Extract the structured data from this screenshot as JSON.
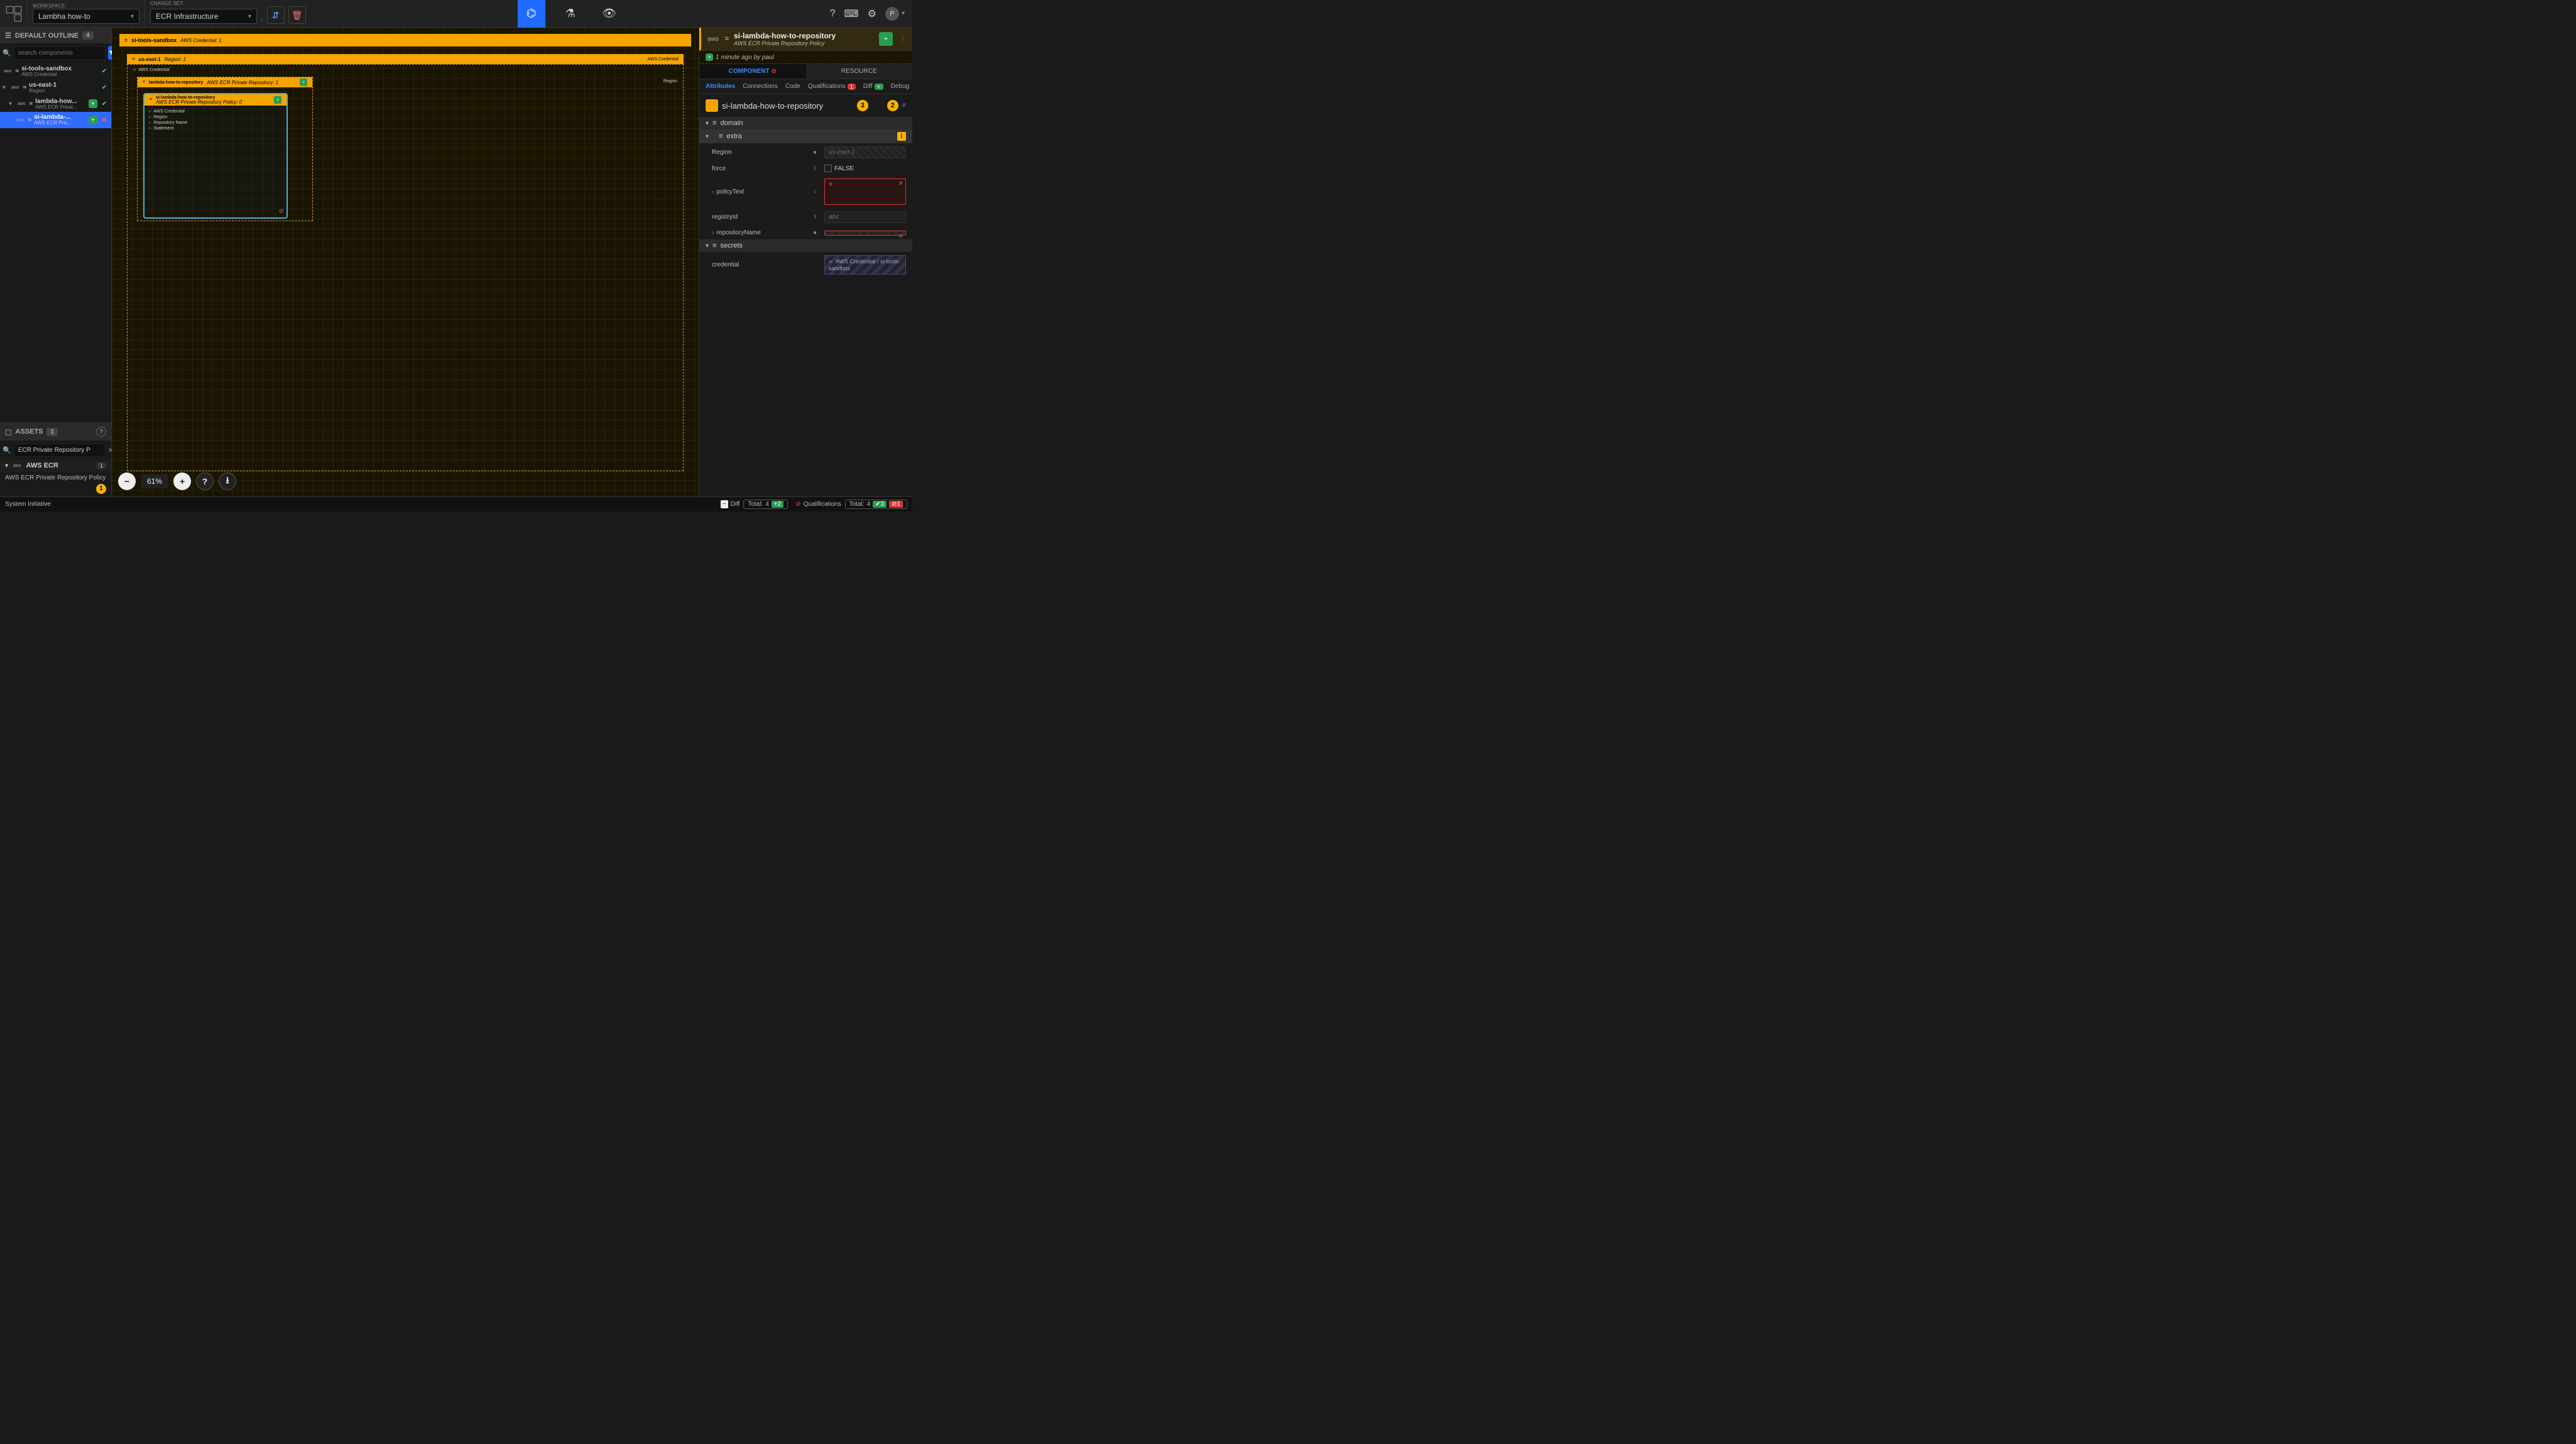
{
  "topbar": {
    "workspace_label": "WORKSPACE:",
    "workspace_value": "Lambha how-to",
    "changeset_label": "CHANGE SET:",
    "changeset_value": "ECR Infrastructure",
    "avatar_initial": "P"
  },
  "outline": {
    "title": "DEFAULT OUTLINE",
    "count": "4",
    "search_placeholder": "search components",
    "items": [
      {
        "name": "si-tools-sandbox",
        "subtype": "AWS Credential",
        "status": "green"
      },
      {
        "name": "us-east-1",
        "subtype": "Region",
        "status": "green"
      },
      {
        "name": "lambda-how...",
        "subtype": "AWS ECR Privat...",
        "status": "green",
        "plus": true
      },
      {
        "name": "si-lambda-...",
        "subtype": "AWS ECR Priv...",
        "status": "red",
        "plus": true,
        "selected": true
      }
    ]
  },
  "assets": {
    "title": "ASSETS",
    "count": "1",
    "search_value": "ECR Private Repository P",
    "group_name": "AWS ECR",
    "group_count": "1",
    "item_name": "AWS ECR Private Repository Policy",
    "item_badge": "1"
  },
  "canvas": {
    "bar1_name": "si-tools-sandbox",
    "bar1_sub": "AWS Credential: 1",
    "bar2_name": "us-east-1",
    "bar2_sub": "Region: 1",
    "bar2_right": "AWS Credential",
    "inner1_name": "lambda-how-to-repository",
    "inner1_sub": "AWS ECR Private Repository: 1",
    "inner2_name": "si-lambda-how-to-repository",
    "inner2_sub": "AWS ECR Private Repository Policy: 0",
    "region_label": "Region",
    "sockets": [
      "AWS Credential",
      "Region",
      "Repository Name",
      "Statement"
    ],
    "zoom": "61%"
  },
  "right": {
    "title": "si-lambda-how-to-repository",
    "subtitle": "AWS ECR Private Repository Policy",
    "timestamp": "1 minute ago by paul",
    "tab_component": "COMPONENT",
    "tab_resource": "RESOURCE",
    "subtabs": {
      "attributes": "Attributes",
      "connections": "Connections",
      "code": "Code",
      "qualifications": "Qualifications",
      "qual_count": "1",
      "diff": "Diff",
      "debug": "Debug"
    },
    "name_value": "si-lambda-how-to-repository",
    "name_badge_a": "3",
    "name_badge_b": "2",
    "sec_domain": "domain",
    "sec_extra": "extra",
    "attrs": {
      "region_label": "Region",
      "region_value": "us-east-1",
      "force_label": "force",
      "force_value": "FALSE",
      "policy_label": "policyText",
      "registry_label": "registryId",
      "registry_placeholder": "abc",
      "repo_label": "repositoryName"
    },
    "sec_secrets": "secrets",
    "secret_label": "credential",
    "secret_value": "AWS Credential / si-tools-sandbox"
  },
  "statusbar": {
    "brand": "System Initiative",
    "diff_label": "Diff",
    "total_label": "Total:",
    "total_a": "4",
    "total_a_g": "2",
    "qual_label": "Qualifications",
    "qual_total": "4",
    "qual_g": "3",
    "qual_r": "1"
  }
}
